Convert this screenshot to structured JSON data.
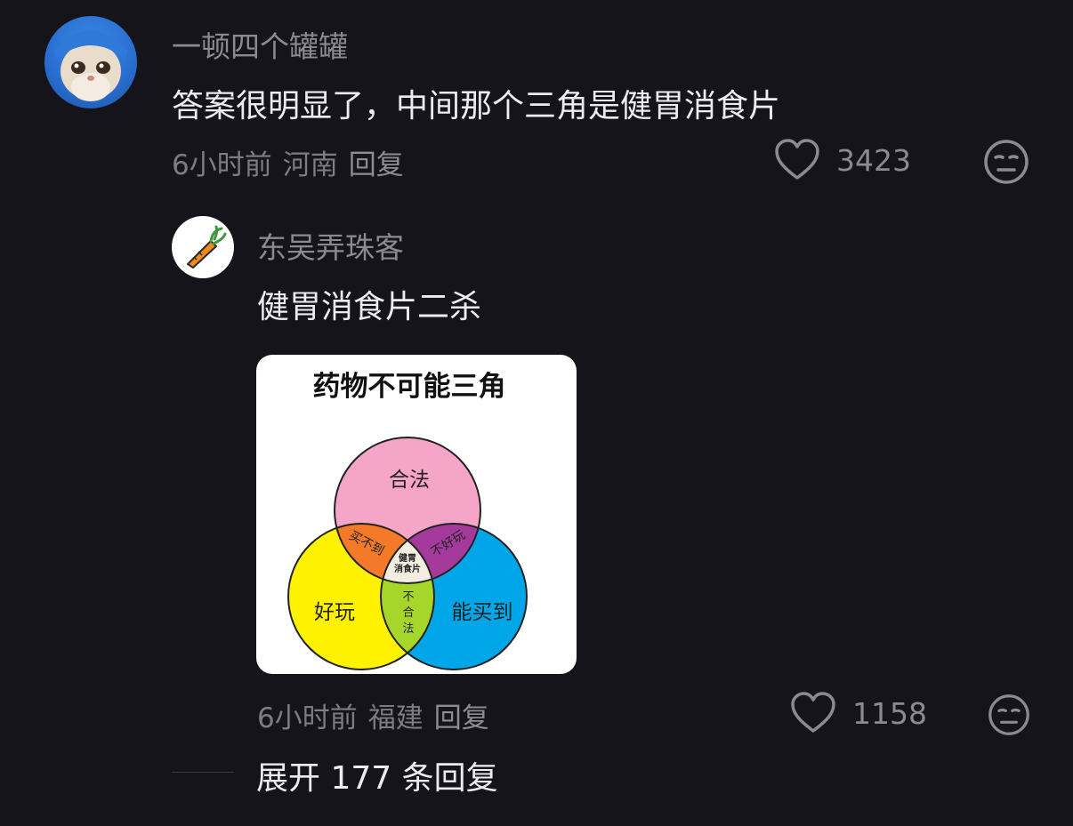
{
  "comments": [
    {
      "username": "一顿四个罐罐",
      "text": "答案很明显了，中间那个三角是健胃消食片",
      "time": "6小时前",
      "location": "河南",
      "reply_label": "回复",
      "likes": "3423",
      "avatar_icon": "cat-in-blue-hood-avatar"
    },
    {
      "username": "东吴弄珠客",
      "text": "健胃消食片二杀",
      "time": "6小时前",
      "location": "福建",
      "reply_label": "回复",
      "likes": "1158",
      "avatar_icon": "carrot-avatar",
      "image": {
        "title": "药物不可能三角",
        "circles": {
          "top": "合法",
          "left": "好玩",
          "right": "能买到"
        },
        "overlaps": {
          "top_left": "买不到",
          "top_right": "不好玩",
          "bottom": "不合法",
          "center_line1": "健胃",
          "center_line2": "消食片"
        },
        "colors": {
          "top": "#f5a6c8",
          "left": "#fff200",
          "right": "#00a6e8",
          "top_left": "#f47a2a",
          "top_right": "#a43a9c",
          "bottom": "#a6d62a",
          "center": "#f3ece0"
        }
      }
    }
  ],
  "expand_replies": "展开 177 条回复"
}
